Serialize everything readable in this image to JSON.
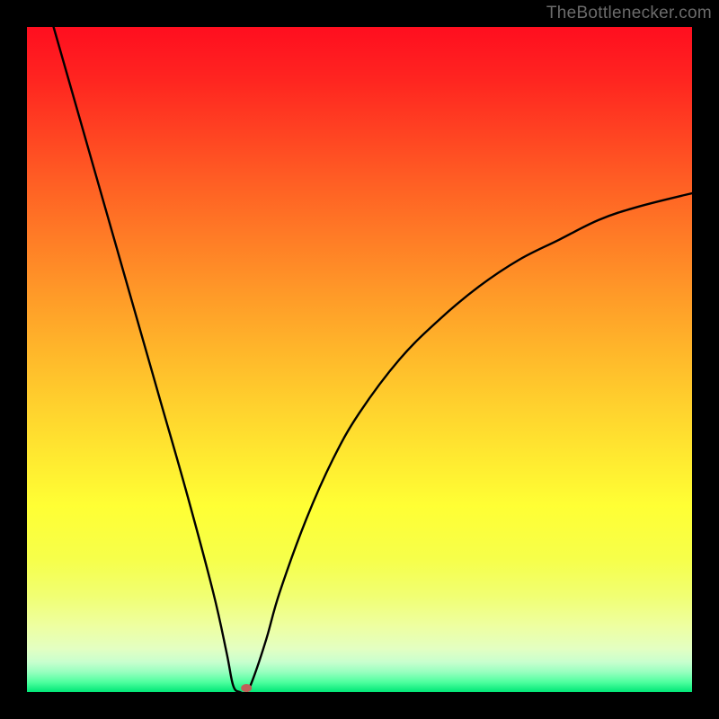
{
  "watermark": "TheBottlenecker.com",
  "chart_data": {
    "type": "line",
    "title": "",
    "xlabel": "",
    "ylabel": "",
    "xlim": [
      0,
      100
    ],
    "ylim": [
      0,
      100
    ],
    "optimum_x": 32,
    "marker": {
      "x": 33,
      "y": 0.6,
      "color": "#c06058"
    },
    "curve": [
      {
        "x": 4,
        "y": 100
      },
      {
        "x": 8,
        "y": 86
      },
      {
        "x": 12,
        "y": 72
      },
      {
        "x": 16,
        "y": 58
      },
      {
        "x": 20,
        "y": 44
      },
      {
        "x": 24,
        "y": 30
      },
      {
        "x": 28,
        "y": 15
      },
      {
        "x": 30,
        "y": 6
      },
      {
        "x": 31,
        "y": 1
      },
      {
        "x": 32,
        "y": 0
      },
      {
        "x": 33,
        "y": 0
      },
      {
        "x": 34,
        "y": 2
      },
      {
        "x": 36,
        "y": 8
      },
      {
        "x": 38,
        "y": 15
      },
      {
        "x": 42,
        "y": 26
      },
      {
        "x": 46,
        "y": 35
      },
      {
        "x": 50,
        "y": 42
      },
      {
        "x": 56,
        "y": 50
      },
      {
        "x": 62,
        "y": 56
      },
      {
        "x": 68,
        "y": 61
      },
      {
        "x": 74,
        "y": 65
      },
      {
        "x": 80,
        "y": 68
      },
      {
        "x": 86,
        "y": 71
      },
      {
        "x": 92,
        "y": 73
      },
      {
        "x": 100,
        "y": 75
      }
    ],
    "gradient_stops": [
      {
        "offset": 0.0,
        "color": "#ff0e1f"
      },
      {
        "offset": 0.08,
        "color": "#ff2520"
      },
      {
        "offset": 0.16,
        "color": "#ff4322"
      },
      {
        "offset": 0.24,
        "color": "#ff6124"
      },
      {
        "offset": 0.32,
        "color": "#ff7d26"
      },
      {
        "offset": 0.4,
        "color": "#ff9928"
      },
      {
        "offset": 0.48,
        "color": "#ffb42a"
      },
      {
        "offset": 0.56,
        "color": "#ffce2d"
      },
      {
        "offset": 0.64,
        "color": "#ffe730"
      },
      {
        "offset": 0.72,
        "color": "#ffff34"
      },
      {
        "offset": 0.8,
        "color": "#f6ff4a"
      },
      {
        "offset": 0.855,
        "color": "#f1ff72"
      },
      {
        "offset": 0.9,
        "color": "#eeffa0"
      },
      {
        "offset": 0.935,
        "color": "#e3ffc2"
      },
      {
        "offset": 0.955,
        "color": "#c8ffce"
      },
      {
        "offset": 0.97,
        "color": "#97ffbf"
      },
      {
        "offset": 0.985,
        "color": "#4fff9f"
      },
      {
        "offset": 1.0,
        "color": "#00e777"
      }
    ]
  }
}
